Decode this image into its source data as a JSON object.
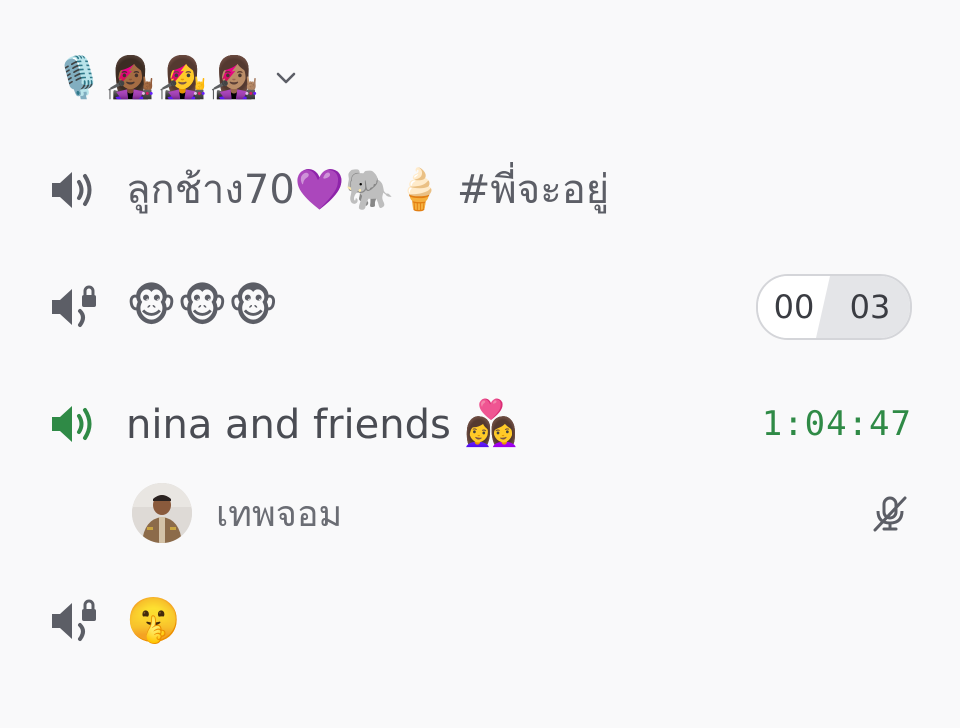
{
  "category": {
    "emoji": "🎙️👩🏾‍🎤👩‍🎤👩🏽‍🎤"
  },
  "channels": [
    {
      "name": "ลูกช้าง70💜🐘🍦 #พี่จะอยู่",
      "icon": "speaker-icon",
      "state": "normal"
    },
    {
      "name": "🐵🐵🐵",
      "icon": "speaker-lock-icon",
      "user_count_connected": "00",
      "user_limit": "03"
    },
    {
      "name_text": "nina and friends ",
      "name_emoji": "👩‍❤️‍👩",
      "icon": "speaker-icon",
      "state": "active",
      "timer": "1:04:47",
      "users": [
        {
          "name": "เทพจอม",
          "muted": true
        }
      ]
    },
    {
      "name": "🤫",
      "icon": "speaker-lock-icon"
    }
  ],
  "colors": {
    "icon_gray": "#5c5e66",
    "active_green": "#2f8a46",
    "background": "#f9f9fa"
  }
}
